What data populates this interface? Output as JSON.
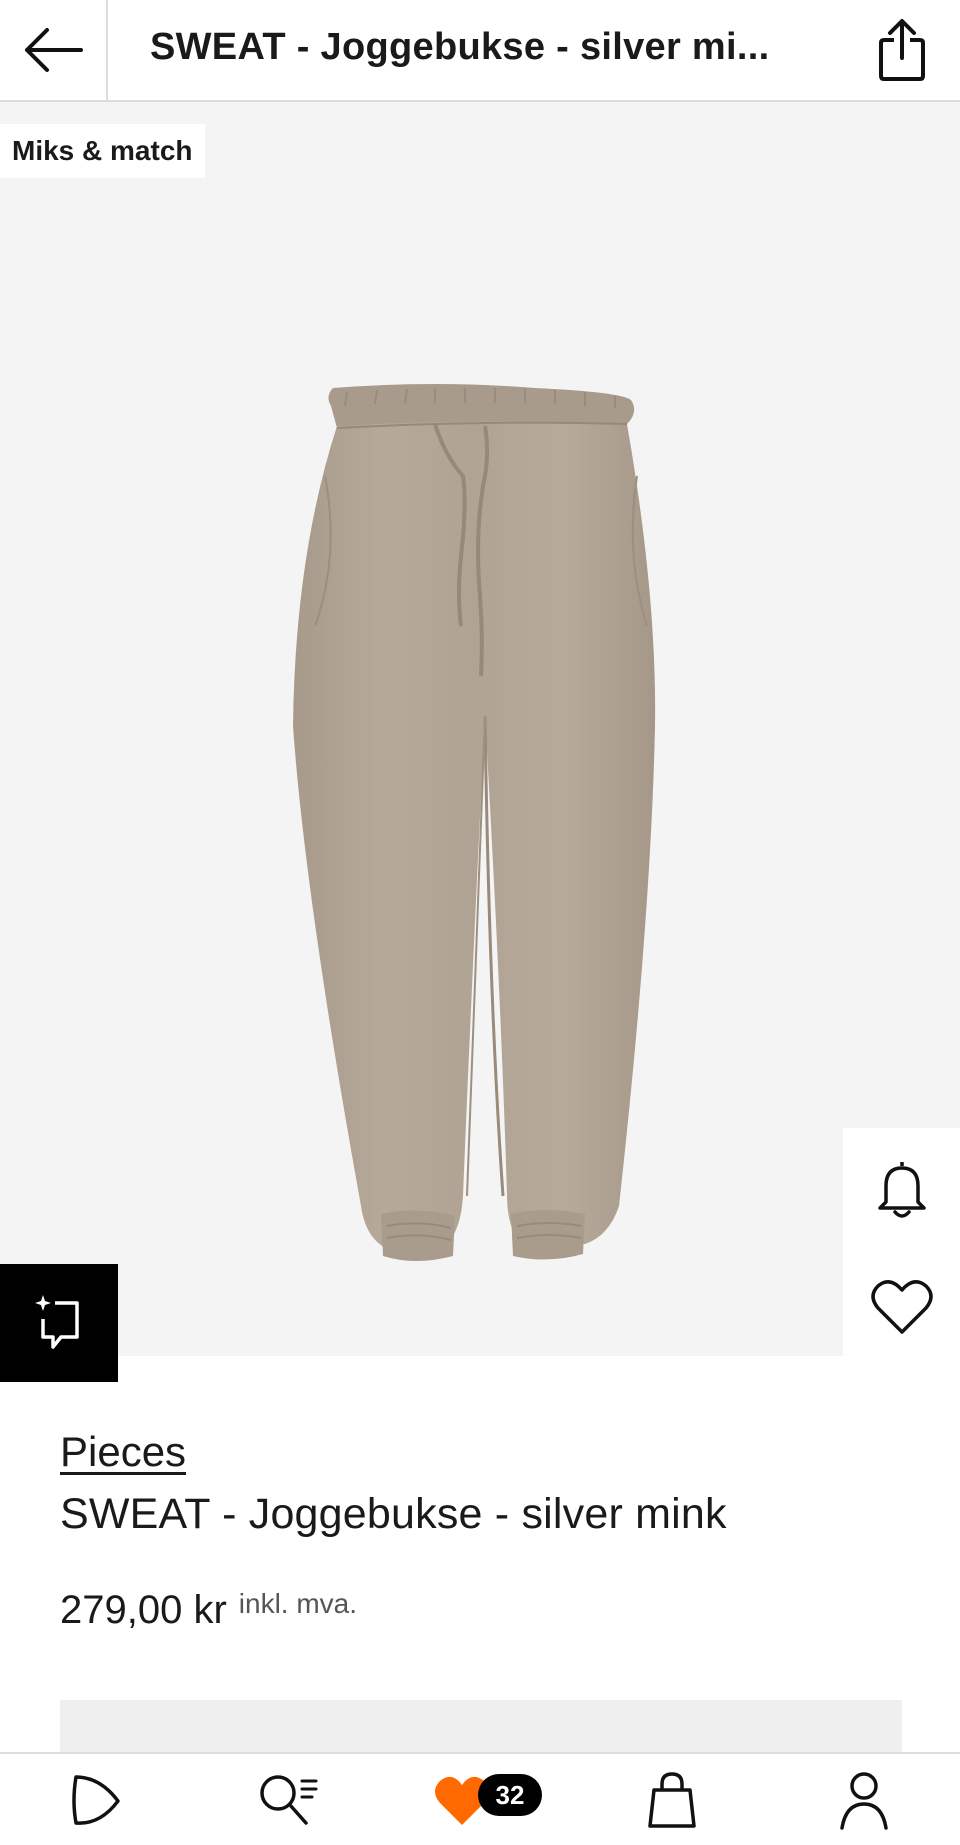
{
  "header": {
    "title": "SWEAT - Joggebukse - silver mi..."
  },
  "image": {
    "badge": "Miks & match",
    "image_index": 1
  },
  "product": {
    "brand": "Pieces",
    "name": "SWEAT - Joggebukse - silver mink",
    "price": "279,00 kr",
    "vat_note": "inkl. mva."
  },
  "nav": {
    "items": [
      {
        "icon": "play-icon"
      },
      {
        "icon": "search-icon"
      },
      {
        "icon": "heart-icon",
        "count": "32"
      },
      {
        "icon": "bag-icon"
      },
      {
        "icon": "profile-icon"
      }
    ]
  },
  "colors": {
    "accent": "#ff6900",
    "product_color": "#b4a797",
    "background": "#f4f4f4"
  }
}
